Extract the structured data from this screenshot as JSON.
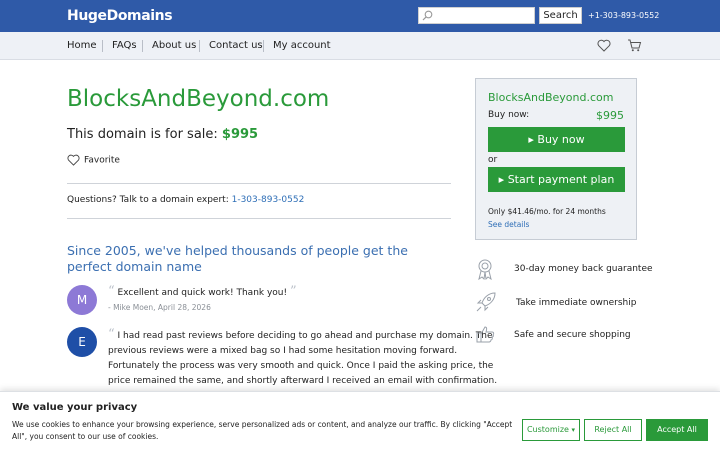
{
  "header": {
    "logo": "HugeDomains",
    "search_placeholder": "",
    "search_button": "Search",
    "phone": "+1-303-893-0552"
  },
  "nav": {
    "items": [
      "Home",
      "FAQs",
      "About us",
      "Contact us",
      "My account"
    ]
  },
  "main": {
    "domain": "BlocksAndBeyond.com",
    "sale_prefix": "This domain is for sale:",
    "sale_price": "$995",
    "favorite": "Favorite",
    "questions": "Questions? Talk to a domain expert:",
    "questions_phone": "1-303-893-0552",
    "since_heading": "Since 2005, we've helped thousands of people get the perfect domain name"
  },
  "reviews": [
    {
      "initial": "M",
      "color": "#8d79d6",
      "text": "Excellent and quick work! Thank you!",
      "author": "- Mike Moen, April 28, 2026"
    },
    {
      "initial": "E",
      "color": "#1f4fa7",
      "lines": [
        "I had read past reviews before deciding to go ahead and purchase my domain. The",
        "previous reviews were a mixed bag so I had some hesitation moving forward.",
        "Fortunately the process was very smooth and quick. Once I paid the asking price, the",
        "price remained the same, and shortly afterward I received an email with confirmation."
      ]
    }
  ],
  "buybox": {
    "domain": "BlocksAndBeyond.com",
    "buy_now_label": "Buy now:",
    "price": "$995",
    "buy_now_button": "▸ Buy now",
    "or": "or",
    "payment_plan_button": "▸ Start payment plan",
    "monthly": "Only $41.46/mo. for 24 months",
    "see_details": "See details"
  },
  "guarantees": [
    {
      "icon": "ribbon-icon",
      "label": "30-day money back guarantee"
    },
    {
      "icon": "rocket-icon",
      "label": "Take immediate ownership"
    },
    {
      "icon": "thumbs-up-icon",
      "label": "Safe and secure shopping"
    }
  ],
  "cookie": {
    "title": "We value your privacy",
    "text": "We use cookies to enhance your browsing experience, serve personalized ads or content, and analyze our traffic. By clicking \"Accept All\", you consent to our use of cookies.",
    "customize": "Customize",
    "reject": "Reject All",
    "accept": "Accept All"
  },
  "colors": {
    "brand_blue": "#2f5aa8",
    "green": "#2a9a3a",
    "link_blue": "#2f6fb7"
  }
}
